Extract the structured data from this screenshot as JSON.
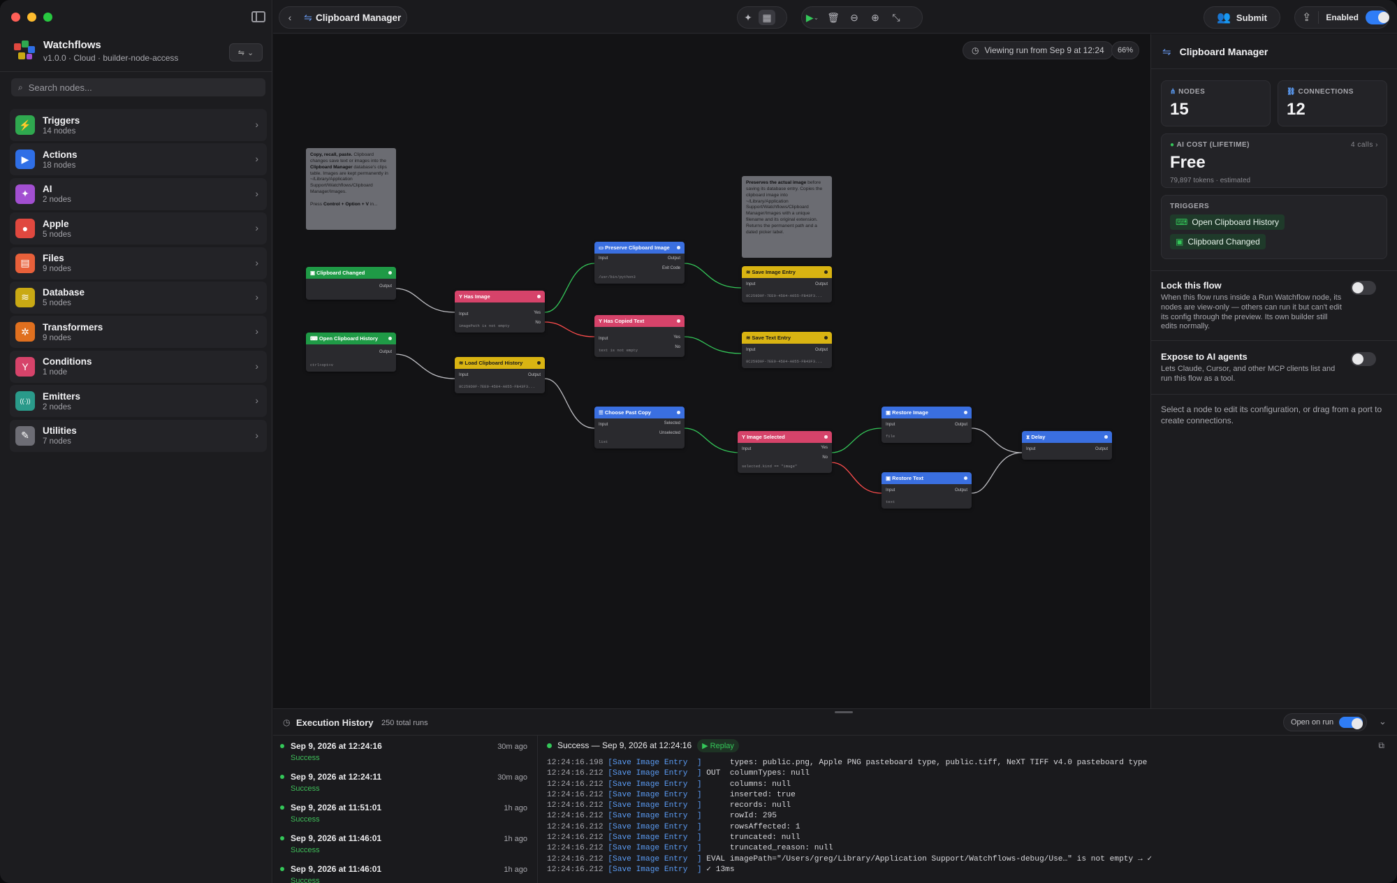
{
  "app": {
    "name": "Watchflows",
    "subtitle": "v1.0.0 · Cloud · builder-node-access"
  },
  "search": {
    "placeholder": "Search nodes..."
  },
  "categories": [
    {
      "label": "Triggers",
      "count": "14 nodes",
      "color": "#2fa84f",
      "icon": "⚡"
    },
    {
      "label": "Actions",
      "count": "18 nodes",
      "color": "#2f6fe6",
      "icon": "▶"
    },
    {
      "label": "AI",
      "count": "2 nodes",
      "color": "#a24fd1",
      "icon": "✦"
    },
    {
      "label": "Apple",
      "count": "5 nodes",
      "color": "#e0483f",
      "icon": "●"
    },
    {
      "label": "Files",
      "count": "9 nodes",
      "color": "#e8603a",
      "icon": "▤"
    },
    {
      "label": "Database",
      "count": "5 nodes",
      "color": "#c9a914",
      "icon": "≋"
    },
    {
      "label": "Transformers",
      "count": "9 nodes",
      "color": "#e0701f",
      "icon": "✲"
    },
    {
      "label": "Conditions",
      "count": "1 node",
      "color": "#d6436a",
      "icon": "Y"
    },
    {
      "label": "Emitters",
      "count": "2 nodes",
      "color": "#2a9a8a",
      "icon": "((·))"
    },
    {
      "label": "Utilities",
      "count": "7 nodes",
      "color": "#6d6d75",
      "icon": "✎"
    }
  ],
  "toolbar": {
    "title": "Clipboard Manager",
    "submit": "Submit",
    "enabled": "Enabled"
  },
  "canvas": {
    "viewing": "Viewing run from Sep 9 at 12:24",
    "zoom": "66%",
    "note1": {
      "title": "Copy, recall, paste.",
      "body1": " Clipboard changes save text or images into the ",
      "bold1": "Clipboard Manager",
      "body2": " database's clips table. Images are kept permanently in ~/Library/Application Support/Watchflows/Clipboard Manager/Images.",
      "body3": "Press ",
      "bold2": "Control + Option + V",
      "body4": " in..."
    },
    "note2": {
      "title": "Preserves the actual image",
      "body": " before saving its database entry. Copies the clipboard image into ~/Library/Application Support/Watchflows/Clipboard Manager/Images with a unique filename and its original extension. Returns the permanent path and a dated picker label."
    },
    "nodes": {
      "clipboard_changed": {
        "title": "Clipboard Changed",
        "out": "Output"
      },
      "open_history": {
        "title": "Open Clipboard History",
        "out": "Output",
        "sub": "ctrl+opt+v"
      },
      "has_image": {
        "title": "Has Image",
        "in": "Input",
        "yes": "Yes",
        "no": "No",
        "sub": "imagePath is not empty"
      },
      "load_history": {
        "title": "Load Clipboard History",
        "in": "Input",
        "out": "Output",
        "sub": "8C259D0F-7EE9-4584-A055-FB43F3..."
      },
      "preserve_image": {
        "title": "Preserve Clipboard Image",
        "in": "Input",
        "out": "Output",
        "exit": "Exit Code",
        "sub": "/usr/bin/python3"
      },
      "has_copied_text": {
        "title": "Has Copied Text",
        "in": "Input",
        "yes": "Yes",
        "no": "No",
        "sub": "text is not empty"
      },
      "choose_past": {
        "title": "Choose Past Copy",
        "in": "Input",
        "sel": "Selected",
        "unsel": "Unselected",
        "sub": "list"
      },
      "save_image": {
        "title": "Save Image Entry",
        "in": "Input",
        "out": "Output",
        "sub": "8C259D0F-7EE9-4584-A055-FB43F3..."
      },
      "save_text": {
        "title": "Save Text Entry",
        "in": "Input",
        "out": "Output",
        "sub": "8C259D0F-7EE9-4584-A055-FB43F3..."
      },
      "image_selected": {
        "title": "Image Selected",
        "in": "Input",
        "yes": "Yes",
        "no": "No",
        "sub": "selected.kind == \"image\""
      },
      "restore_image": {
        "title": "Restore Image",
        "in": "Input",
        "out": "Output",
        "sub": "file"
      },
      "restore_text": {
        "title": "Restore Text",
        "in": "Input",
        "out": "Output",
        "sub": "text"
      },
      "delay": {
        "title": "Delay",
        "in": "Input",
        "out": "Output"
      }
    }
  },
  "panel": {
    "title": "Clipboard Manager",
    "nodes_label": "NODES",
    "nodes_value": "15",
    "conn_label": "CONNECTIONS",
    "conn_value": "12",
    "cost_label": "AI COST (LIFETIME)",
    "cost_calls": "4 calls",
    "cost_value": "Free",
    "cost_sub": "79,897 tokens · estimated",
    "triggers_label": "TRIGGERS",
    "triggers": [
      "Open Clipboard History",
      "Clipboard Changed"
    ],
    "lock_title": "Lock this flow",
    "lock_desc": "When this flow runs inside a Run Watchflow node, its nodes are view-only — others can run it but can't edit its config through the preview. Its own builder still edits normally.",
    "expose_title": "Expose to AI agents",
    "expose_desc": "Lets Claude, Cursor, and other MCP clients list and run this flow as a tool.",
    "hint": "Select a node to edit its configuration, or drag from a port to create connections."
  },
  "history": {
    "title": "Execution History",
    "total": "250 total runs",
    "open_on_run": "Open on run",
    "runs": [
      {
        "date": "Sep 9, 2026 at 12:24:16",
        "status": "Success",
        "ago": "30m ago"
      },
      {
        "date": "Sep 9, 2026 at 12:24:11",
        "status": "Success",
        "ago": "30m ago"
      },
      {
        "date": "Sep 9, 2026 at 11:51:01",
        "status": "Success",
        "ago": "1h ago"
      },
      {
        "date": "Sep 9, 2026 at 11:46:01",
        "status": "Success",
        "ago": "1h ago"
      },
      {
        "date": "Sep 9, 2026 at 11:46:01",
        "status": "Success",
        "ago": "1h ago"
      }
    ],
    "log_status": "Success — Sep 9, 2026 at 12:24:16",
    "replay": "▶ Replay",
    "log": [
      {
        "ts": "12:24:16.198",
        "node": "[Save Image Entry  ]",
        "msg": "      types: public.png, Apple PNG pasteboard type, public.tiff, NeXT TIFF v4.0 pasteboard type"
      },
      {
        "ts": "12:24:16.212",
        "node": "[Save Image Entry  ]",
        "msg": " OUT  columnTypes: null"
      },
      {
        "ts": "12:24:16.212",
        "node": "[Save Image Entry  ]",
        "msg": "      columns: null"
      },
      {
        "ts": "12:24:16.212",
        "node": "[Save Image Entry  ]",
        "msg": "      inserted: true"
      },
      {
        "ts": "12:24:16.212",
        "node": "[Save Image Entry  ]",
        "msg": "      records: null"
      },
      {
        "ts": "12:24:16.212",
        "node": "[Save Image Entry  ]",
        "msg": "      rowId: 295"
      },
      {
        "ts": "12:24:16.212",
        "node": "[Save Image Entry  ]",
        "msg": "      rowsAffected: 1"
      },
      {
        "ts": "12:24:16.212",
        "node": "[Save Image Entry  ]",
        "msg": "      truncated: null"
      },
      {
        "ts": "12:24:16.212",
        "node": "[Save Image Entry  ]",
        "msg": "      truncated_reason: null"
      },
      {
        "ts": "12:24:16.212",
        "node": "[Save Image Entry  ]",
        "msg": " EVAL imagePath=\"/Users/greg/Library/Application Support/Watchflows-debug/Use…\" is not empty → ✓"
      },
      {
        "ts": "12:24:16.212",
        "node": "[Save Image Entry  ]",
        "msg": " ✓ 13ms"
      }
    ]
  }
}
